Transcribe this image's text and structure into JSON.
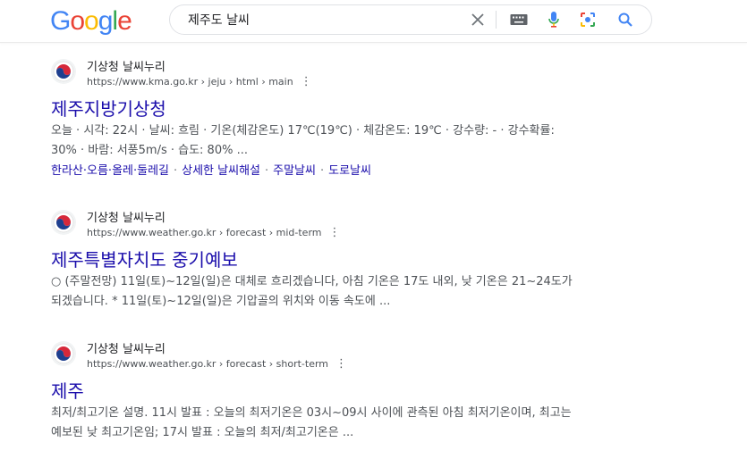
{
  "logo": {
    "letters": [
      "G",
      "o",
      "o",
      "g",
      "l",
      "e"
    ],
    "colors": [
      "#4285F4",
      "#EA4335",
      "#FBBC05",
      "#4285F4",
      "#34A853",
      "#EA4335"
    ]
  },
  "search": {
    "value": "제주도 날씨",
    "clear_icon": "close-icon",
    "keyboard_icon": "keyboard-icon",
    "voice_icon": "microphone-icon",
    "lens_icon": "google-lens-icon",
    "search_icon": "search-icon"
  },
  "results": [
    {
      "site_name": "기상청 날씨누리",
      "url": "https://www.kma.go.kr › jeju › html › main",
      "title": "제주지방기상청",
      "snippet": "오늘 · 시각: 22시 · 날씨: 흐림 · 기온(체감온도) 17℃(19℃) · 체감온도: 19℃ · 강수량: - · 강수확률: 30% · 바람: 서풍5m/s · 습도: 80% ...",
      "sitelinks": [
        "한라산·오름·올레·둘레길",
        "상세한 날씨해설",
        "주말날씨",
        "도로날씨"
      ]
    },
    {
      "site_name": "기상청 날씨누리",
      "url": "https://www.weather.go.kr › forecast › mid-term",
      "title": "제주특별자치도 중기예보",
      "snippet": "○ (주말전망) 11일(토)~12일(일)은 대체로 흐리겠습니다, 아침 기온은 17도 내외, 낮 기온은 21~24도가 되겠습니다. * 11일(토)~12일(일)은 기압골의 위치와 이동 속도에 ..."
    },
    {
      "site_name": "기상청 날씨누리",
      "url": "https://www.weather.go.kr › forecast › short-term",
      "title": "제주",
      "snippet": "최저/최고기온 설명. 11시 발표 : 오늘의 최저기온은 03시~09시 사이에 관측된 아침 최저기온이며, 최고는 예보된 낮 최고기온임; 17시 발표 : 오늘의 최저/최고기온은 ..."
    }
  ],
  "accent_colors": {
    "link": "#1a0dab",
    "text": "#4d5156"
  }
}
